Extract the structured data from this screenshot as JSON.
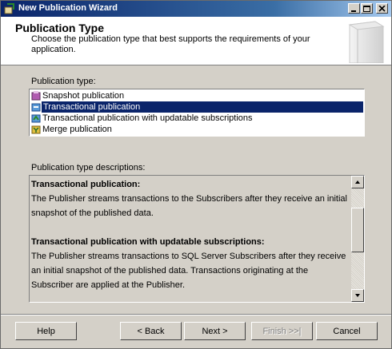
{
  "window": {
    "title": "New Publication Wizard",
    "controls": [
      "minimize-icon",
      "maximize-icon",
      "close-icon"
    ]
  },
  "header": {
    "title": "Publication Type",
    "description": "Choose the publication type that best supports the requirements of your application."
  },
  "publication_type": {
    "label": "Publication type:",
    "items": [
      {
        "label": "Snapshot publication",
        "icon": "snapshot-publication-icon",
        "selected": false
      },
      {
        "label": "Transactional publication",
        "icon": "transactional-publication-icon",
        "selected": true
      },
      {
        "label": "Transactional publication with updatable subscriptions",
        "icon": "updatable-publication-icon",
        "selected": false
      },
      {
        "label": "Merge publication",
        "icon": "merge-publication-icon",
        "selected": false
      }
    ]
  },
  "descriptions": {
    "label": "Publication type descriptions:",
    "sections": [
      {
        "heading": "Transactional publication:",
        "body": "The Publisher streams transactions to the Subscribers after they receive an initial snapshot of the published data."
      },
      {
        "heading": "Transactional publication with updatable subscriptions:",
        "body": "The Publisher streams transactions to SQL Server Subscribers after they receive an initial snapshot of the published data. Transactions originating at the Subscriber are applied at the Publisher."
      }
    ]
  },
  "buttons": {
    "help": "Help",
    "back": "< Back",
    "next": "Next >",
    "finish": "Finish >>|",
    "cancel": "Cancel"
  }
}
